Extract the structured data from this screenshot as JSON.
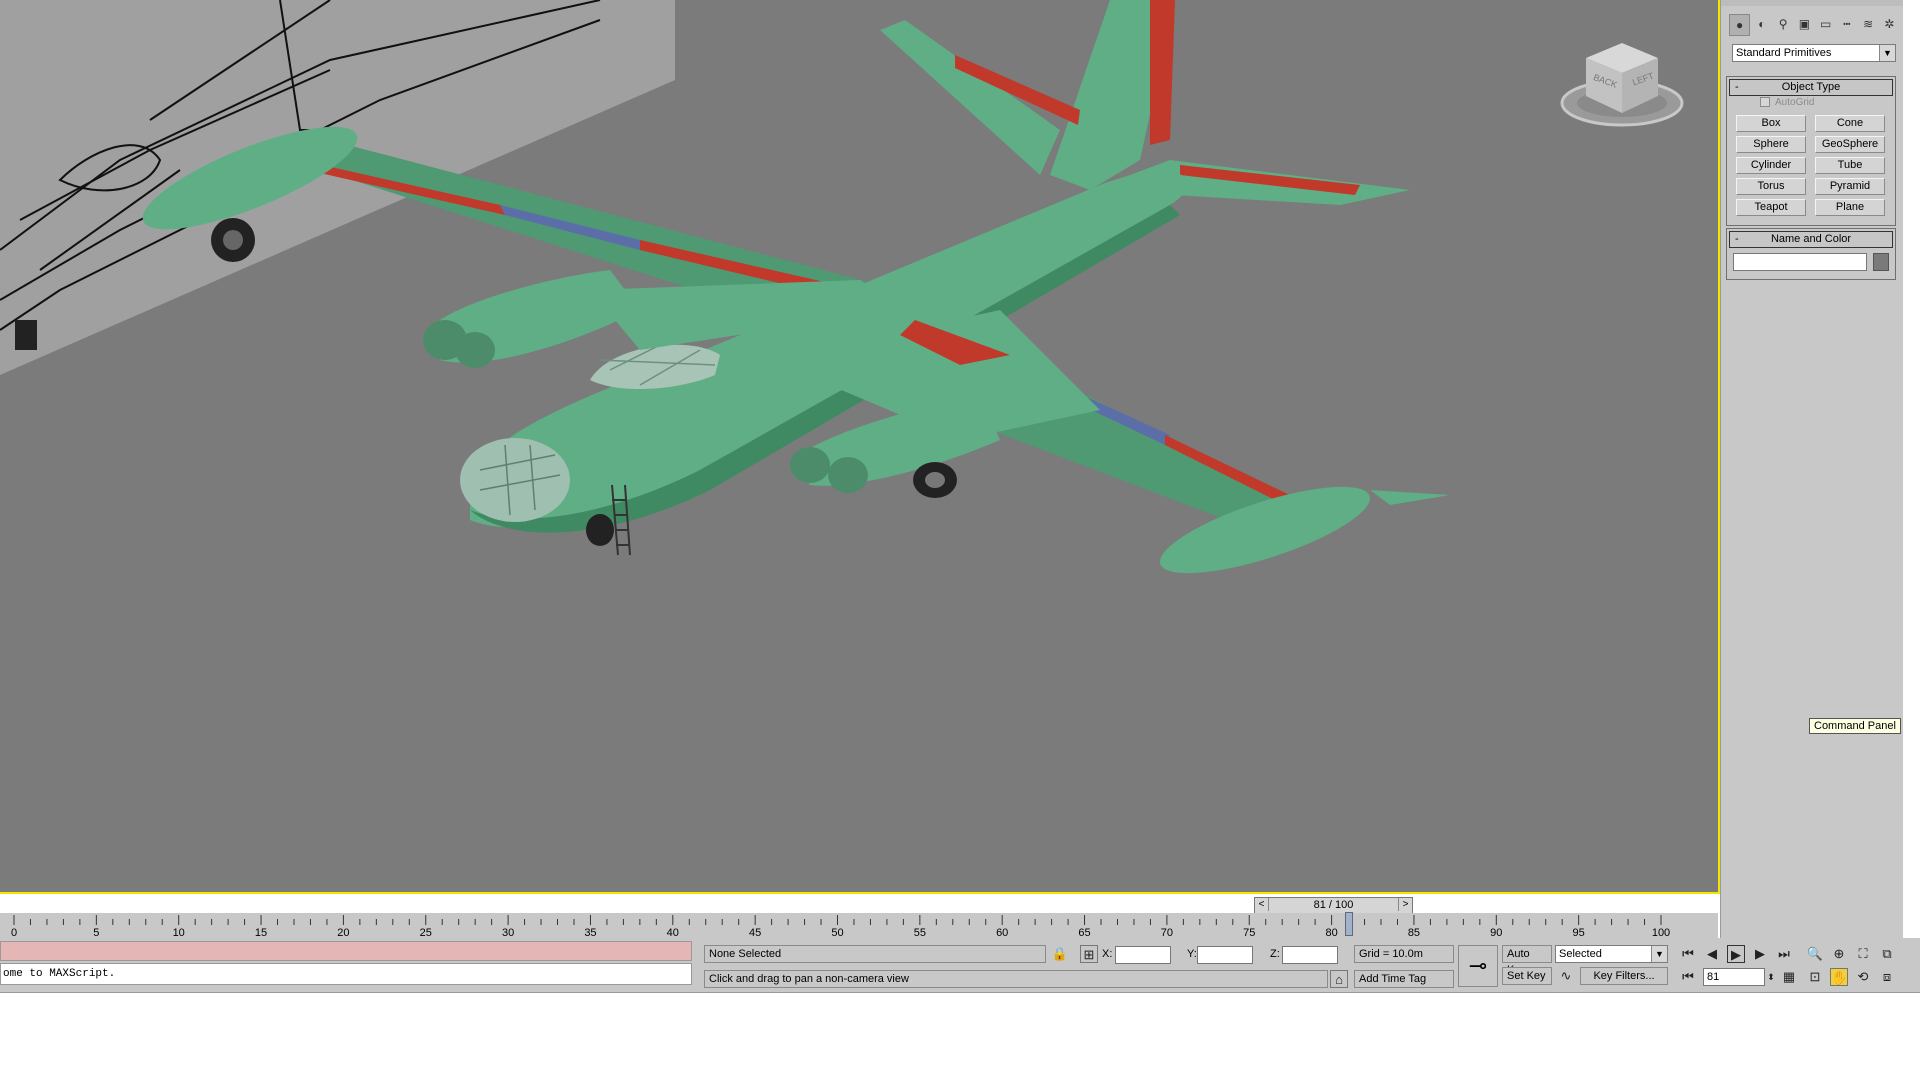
{
  "command_panel": {
    "tab_icons": [
      "create-icon",
      "modify-icon",
      "hierarchy-icon",
      "motion-icon",
      "display-icon",
      "utilities-icon",
      "helpers-icon",
      "systems-icon"
    ],
    "category_dropdown": "Standard Primitives",
    "object_type": {
      "title": "Object Type",
      "collapse": "-",
      "autogrid_label": "AutoGrid",
      "buttons": [
        "Box",
        "Cone",
        "Sphere",
        "GeoSphere",
        "Cylinder",
        "Tube",
        "Torus",
        "Pyramid",
        "Teapot",
        "Plane"
      ]
    },
    "name_and_color": {
      "title": "Name and Color",
      "collapse": "-",
      "name_value": ""
    },
    "tooltip": "Command Panel"
  },
  "viewport": {
    "viewcube_labels": [
      "BACK",
      "LEFT"
    ],
    "aircraft_color": "#5fa880",
    "accent_red": "#c43a30",
    "accent_blue": "#5b6ea8"
  },
  "timeline": {
    "slider_value": "81 / 100",
    "prev": "<",
    "next": ">",
    "current_frame": 81,
    "total_frames": 100,
    "ticks": [
      "0",
      "5",
      "10",
      "15",
      "20",
      "25",
      "30",
      "35",
      "40",
      "45",
      "50",
      "55",
      "60",
      "65",
      "70",
      "75",
      "80",
      "85",
      "90",
      "95",
      "100"
    ]
  },
  "status_bar": {
    "maxscript_output": "ome to MAXScript.",
    "selection": "None Selected",
    "prompt": "Click and drag to pan a non-camera view",
    "x_label": "X:",
    "y_label": "Y:",
    "z_label": "Z:",
    "x_value": "",
    "y_value": "",
    "z_value": "",
    "grid": "Grid = 10.0m",
    "add_time_tag": "Add Time Tag",
    "auto_key": "Auto Key",
    "set_key": "Set Key",
    "key_mode": "Selected",
    "key_filters": "Key Filters...",
    "frame_field": "81"
  }
}
